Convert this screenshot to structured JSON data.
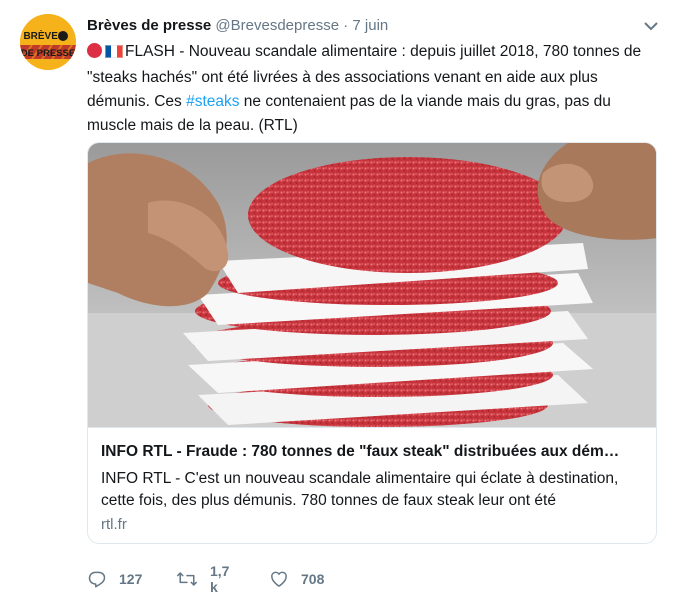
{
  "author": {
    "name": "Brèves de presse",
    "handle": "@Brevesdepresse",
    "separator": "·",
    "time": "7 juin",
    "avatar_text_top": "BRÈVES",
    "avatar_text_bottom": "DE PRESSE"
  },
  "tweet": {
    "emoji_red_circle": "red-circle-emoji",
    "emoji_flag": "france-flag-emoji",
    "text_before_hashtag": "FLASH - Nouveau scandale alimentaire : depuis juillet 2018, 780 tonnes de \"steaks hachés\" ont été livrées à des associations venant en aide aux plus démunis. Ces ",
    "hashtag": "#steaks",
    "text_after_hashtag": " ne contenaient pas de la viande mais du gras, pas du muscle mais de la peau. (RTL)"
  },
  "card": {
    "title": "INFO RTL - Fraude : 780 tonnes de \"faux steak\" distribuées aux dém…",
    "description": "INFO RTL - C'est un nouveau scandale alimentaire qui éclate à destination, cette fois, des plus démunis. 780 tonnes de faux steak leur ont été",
    "domain": "rtl.fr"
  },
  "actions": {
    "replies": "127",
    "retweets": "1,7 k",
    "likes": "708",
    "reply_icon": "reply-icon",
    "retweet_icon": "retweet-icon",
    "like_icon": "heart-icon"
  },
  "colors": {
    "link": "#1da1f2",
    "secondary_text": "#657786",
    "avatar_bg": "#f6b21b",
    "border": "#e1e8ed"
  }
}
